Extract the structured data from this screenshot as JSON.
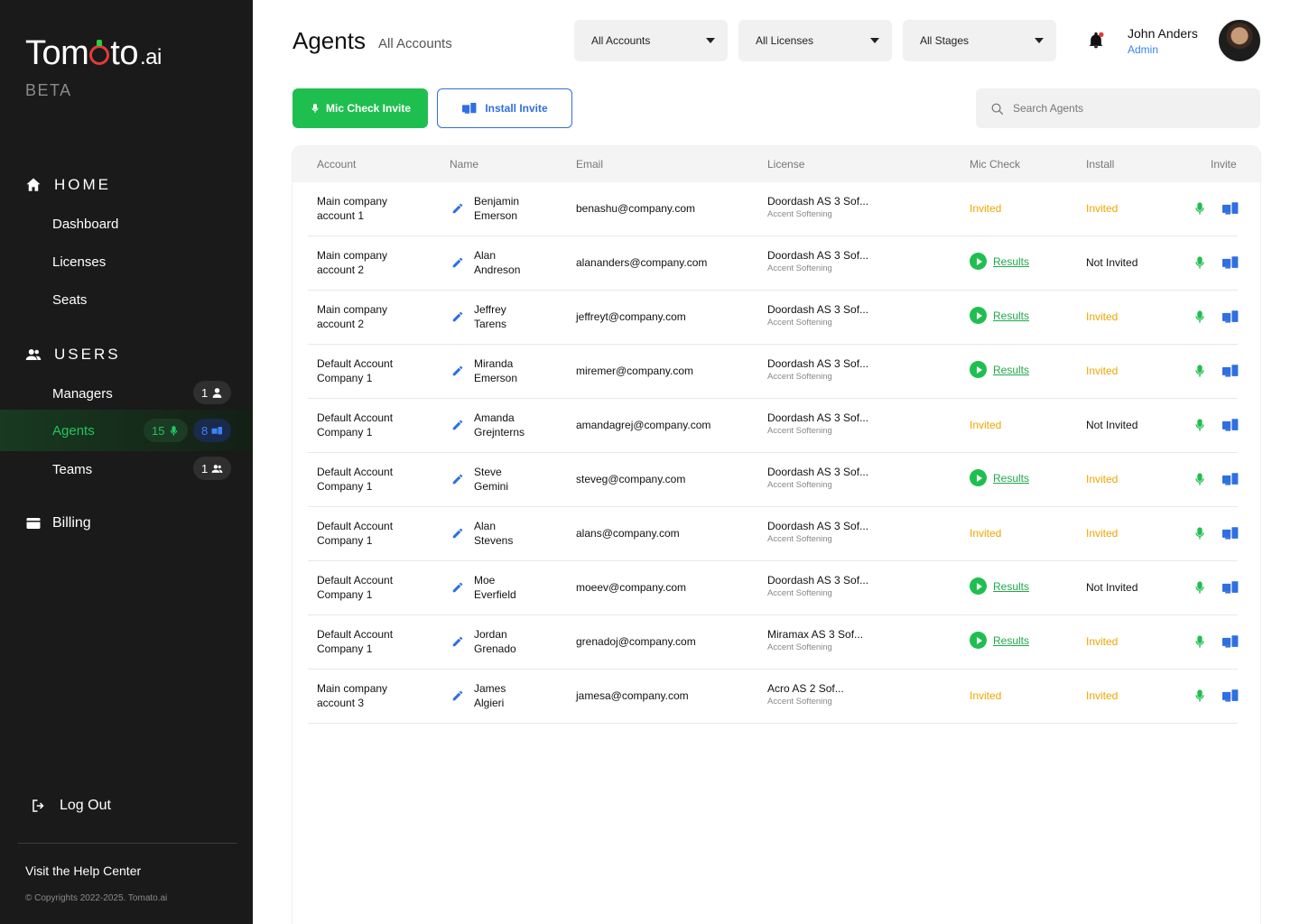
{
  "sidebar": {
    "logo": {
      "part1": "Tom",
      "part2": "to",
      "suffix": ".ai"
    },
    "beta": "BETA",
    "home_section": "HOME",
    "home_items": [
      {
        "label": "Dashboard"
      },
      {
        "label": "Licenses"
      },
      {
        "label": "Seats"
      }
    ],
    "users_section": "USERS",
    "managers": {
      "label": "Managers",
      "badge": "1"
    },
    "agents": {
      "label": "Agents",
      "mic_badge": "15",
      "install_badge": "8"
    },
    "teams": {
      "label": "Teams",
      "badge": "1"
    },
    "billing": "Billing",
    "logout": "Log Out",
    "help": "Visit the Help Center",
    "copyright": "© Copyrights 2022-2025. Tomato.ai",
    "colors": {
      "background": "#1a1a1a",
      "active_text": "#22c55e"
    }
  },
  "header": {
    "title": "Agents",
    "subtitle": "All Accounts",
    "filters": [
      {
        "label": "All Accounts"
      },
      {
        "label": "All Licenses"
      },
      {
        "label": "All Stages"
      }
    ],
    "user": {
      "name": "John Anders",
      "role": "Admin"
    }
  },
  "actions": {
    "mic_check_invite": "Mic Check Invite",
    "install_invite": "Install Invite",
    "search_placeholder": "Search Agents",
    "search_value": ""
  },
  "table": {
    "columns": [
      "Account",
      "Name",
      "Email",
      "License",
      "Mic Check",
      "Install",
      "Invite"
    ],
    "rows": [
      {
        "account": [
          "Main company",
          "account 1"
        ],
        "name": [
          "Benjamin",
          "Emerson"
        ],
        "email": "benashu@company.com",
        "license": "Doordash AS 3 Sof...",
        "license_sub": "Accent Softening",
        "mic": "Invited",
        "install": "Invited"
      },
      {
        "account": [
          "Main company",
          "account 2"
        ],
        "name": [
          "Alan",
          "Andreson"
        ],
        "email": "alananders@company.com",
        "license": "Doordash AS 3 Sof...",
        "license_sub": "Accent Softening",
        "mic": "Results",
        "install": "Not Invited"
      },
      {
        "account": [
          "Main company",
          "account 2"
        ],
        "name": [
          "Jeffrey",
          "Tarens"
        ],
        "email": "jeffreyt@company.com",
        "license": "Doordash AS 3 Sof...",
        "license_sub": "Accent Softening",
        "mic": "Results",
        "install": "Invited"
      },
      {
        "account": [
          "Default Account",
          "Company 1"
        ],
        "name": [
          "Miranda",
          "Emerson"
        ],
        "email": "miremer@company.com",
        "license": "Doordash AS 3 Sof...",
        "license_sub": "Accent Softening",
        "mic": "Results",
        "install": "Invited"
      },
      {
        "account": [
          "Default Account",
          "Company 1"
        ],
        "name": [
          "Amanda",
          "Grejnterns"
        ],
        "email": "amandagrej@company.com",
        "license": "Doordash AS 3 Sof...",
        "license_sub": "Accent Softening",
        "mic": "Invited",
        "install": "Not Invited"
      },
      {
        "account": [
          "Default Account",
          "Company 1"
        ],
        "name": [
          "Steve",
          "Gemini"
        ],
        "email": "steveg@company.com",
        "license": "Doordash AS 3 Sof...",
        "license_sub": "Accent Softening",
        "mic": "Results",
        "install": "Invited"
      },
      {
        "account": [
          "Default Account",
          "Company 1"
        ],
        "name": [
          "Alan",
          "Stevens"
        ],
        "email": "alans@company.com",
        "license": "Doordash AS 3 Sof...",
        "license_sub": "Accent Softening",
        "mic": "Invited",
        "install": "Invited"
      },
      {
        "account": [
          "Default Account",
          "Company 1"
        ],
        "name": [
          "Moe",
          "Everfield"
        ],
        "email": "moeev@company.com",
        "license": "Doordash AS 3 Sof...",
        "license_sub": "Accent Softening",
        "mic": "Results",
        "install": "Not Invited"
      },
      {
        "account": [
          "Default Account",
          "Company 1"
        ],
        "name": [
          "Jordan",
          "Grenado"
        ],
        "email": "grenadoj@company.com",
        "license": "Miramax AS 3 Sof...",
        "license_sub": "Accent Softening",
        "mic": "Results",
        "install": "Invited"
      },
      {
        "account": [
          "Main company",
          "account 3"
        ],
        "name": [
          "James",
          "Algieri"
        ],
        "email": "jamesa@company.com",
        "license": "Acro AS 2 Sof...",
        "license_sub": "Accent Softening",
        "mic": "Invited",
        "install": "Invited"
      }
    ]
  },
  "icons": {
    "home": "home-icon",
    "users": "users-icon",
    "billing": "credit-card-icon",
    "logout": "logout-icon",
    "bell": "bell-icon",
    "search": "search-icon",
    "mic": "mic-icon",
    "install": "devices-icon",
    "edit": "pencil-icon"
  },
  "colors": {
    "primary_green": "#1fbf4f",
    "primary_blue": "#2f6fe0",
    "invited_orange": "#f0a500"
  }
}
